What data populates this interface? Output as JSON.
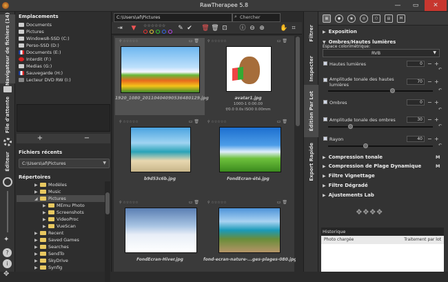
{
  "window": {
    "title": "RawTherapee 5.8",
    "min": "—",
    "max": "▭",
    "close": "✕"
  },
  "left_tabs": {
    "file_browser": "Navigateur de fichiers (14)",
    "queue": "File d'attente",
    "editor": "Éditeur"
  },
  "locations": {
    "title": "Emplacements",
    "items": [
      {
        "label": "Documents",
        "icon": "folder"
      },
      {
        "label": "Pictures",
        "icon": "folder"
      },
      {
        "label": "Windows8-SSD (C:)",
        "icon": "drive"
      },
      {
        "label": "Perso-SSD (D:)",
        "icon": "drive"
      },
      {
        "label": "Documents (E:)",
        "icon": "drive-fr"
      },
      {
        "label": "Interdit (F:)",
        "icon": "drive-no"
      },
      {
        "label": "Medias (G:)",
        "icon": "drive"
      },
      {
        "label": "Sauvegarde (H:)",
        "icon": "drive-fr"
      },
      {
        "label": "Lecteur DVD RW (I:)",
        "icon": "dvd"
      }
    ],
    "add": "+",
    "remove": "−"
  },
  "recent": {
    "title": "Fichiers récents",
    "value": "C:\\Users\\af\\Pictures"
  },
  "tree": {
    "title": "Répertoires",
    "items": [
      {
        "label": "Modèles",
        "indent": 1
      },
      {
        "label": "Music",
        "indent": 1
      },
      {
        "label": "Pictures",
        "indent": 1,
        "open": true
      },
      {
        "label": "MEmu Photo",
        "indent": 2
      },
      {
        "label": "Screenshots",
        "indent": 2
      },
      {
        "label": "VideoProc",
        "indent": 2
      },
      {
        "label": "VueScan",
        "indent": 2
      },
      {
        "label": "Recent",
        "indent": 1
      },
      {
        "label": "Saved Games",
        "indent": 1
      },
      {
        "label": "Searches",
        "indent": 1
      },
      {
        "label": "SendTo",
        "indent": 1
      },
      {
        "label": "SkyDrive",
        "indent": 1
      },
      {
        "label": "Synfig",
        "indent": 1
      }
    ]
  },
  "browser": {
    "path": "C:\\Users\\af\\Pictures",
    "search_placeholder": "Chercher",
    "thumbs": [
      {
        "file": "1920_1080_20110404090536480129.jpg",
        "meta": "",
        "selected": true
      },
      {
        "file": "avatar1.jpg",
        "meta": "1000-1 0:00.00\nf/0.0 0.0s ISO0 0.00mm",
        "selected": false
      },
      {
        "file": "b9d53c6b.jpg",
        "meta": "",
        "selected": false
      },
      {
        "file": "FondEcran-été.jpg",
        "meta": "",
        "selected": false
      },
      {
        "file": "FondEcran-Hiver.jpg",
        "meta": "",
        "selected": false
      },
      {
        "file": "fond-ecran-nature-...ges-plages-080.jpg",
        "meta": "",
        "selected": false
      }
    ]
  },
  "right_tabs": {
    "filter": "Filtrer",
    "inspect": "Inspecter",
    "batch": "Édition Par Lot",
    "export": "Export Rapide"
  },
  "panel": {
    "exposure": "Exposition",
    "shadows_highlights": "Ombres/Hautes lumières",
    "colorspace_label": "Espace colorimétrique:",
    "colorspace_value": "RVB",
    "highlights": "Hautes lumières",
    "highlights_val": "0",
    "hl_range": "Amplitude tonale des hautes lumières",
    "hl_range_val": "70",
    "shadows": "Ombres",
    "shadows_val": "0",
    "sh_range": "Amplitude tonale des ombres",
    "sh_range_val": "30",
    "radius": "Rayon",
    "radius_val": "40",
    "tone_comp": "Compression tonale",
    "dr_comp": "Compression de Plage Dynamique",
    "vignette": "Filtre Vignettage",
    "gradient": "Filtre Dégradé",
    "lab": "Ajustements Lab",
    "history": "Historique",
    "hist_col1": "Photo chargée",
    "hist_col2": "Traitement par lot"
  }
}
